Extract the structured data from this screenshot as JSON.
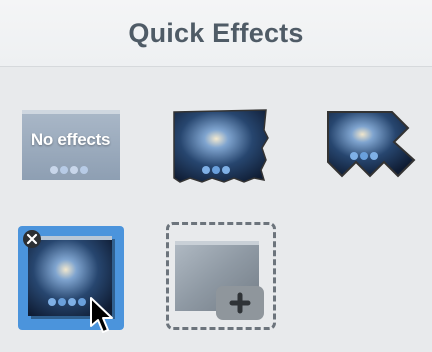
{
  "panel": {
    "title": "Quick Effects"
  },
  "effects": [
    {
      "id": "none",
      "label": "No effects",
      "icon": "thumbnail-plain-icon",
      "selected": false
    },
    {
      "id": "torn-edge",
      "label": "",
      "icon": "thumbnail-torn-edge-icon",
      "selected": false
    },
    {
      "id": "zigzag",
      "label": "",
      "icon": "thumbnail-zigzag-edge-icon",
      "selected": false
    },
    {
      "id": "custom-selected",
      "label": "",
      "icon": "thumbnail-shadow-icon",
      "selected": true
    }
  ],
  "add_slot": {
    "icon": "plus-icon"
  },
  "colors": {
    "selection": "#4b94dc",
    "header_text": "#4f5b66",
    "background": "#e8eaec"
  }
}
